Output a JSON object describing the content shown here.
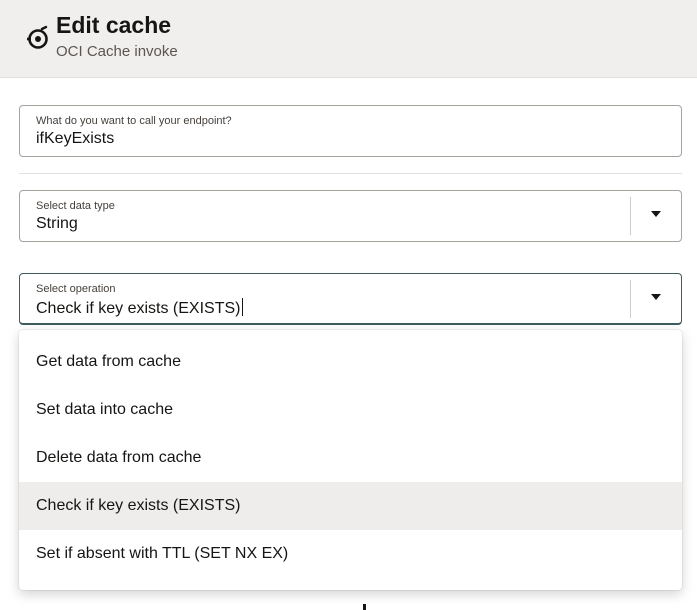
{
  "header": {
    "title": "Edit cache",
    "subtitle": "OCI Cache invoke",
    "icon": "cache-ring-icon"
  },
  "fields": {
    "endpoint": {
      "label": "What do you want to call your endpoint?",
      "value": "ifKeyExists"
    },
    "data_type": {
      "label": "Select data type",
      "value": "String"
    },
    "operation": {
      "label": "Select operation",
      "value": "Check if key exists (EXISTS)"
    }
  },
  "operation_menu": {
    "items": [
      {
        "label": "Get data from cache"
      },
      {
        "label": "Set data into cache"
      },
      {
        "label": "Delete data from cache"
      },
      {
        "label": "Check if key exists (EXISTS)",
        "selected": true
      },
      {
        "label": "Set if absent with TTL (SET NX EX)"
      }
    ]
  }
}
